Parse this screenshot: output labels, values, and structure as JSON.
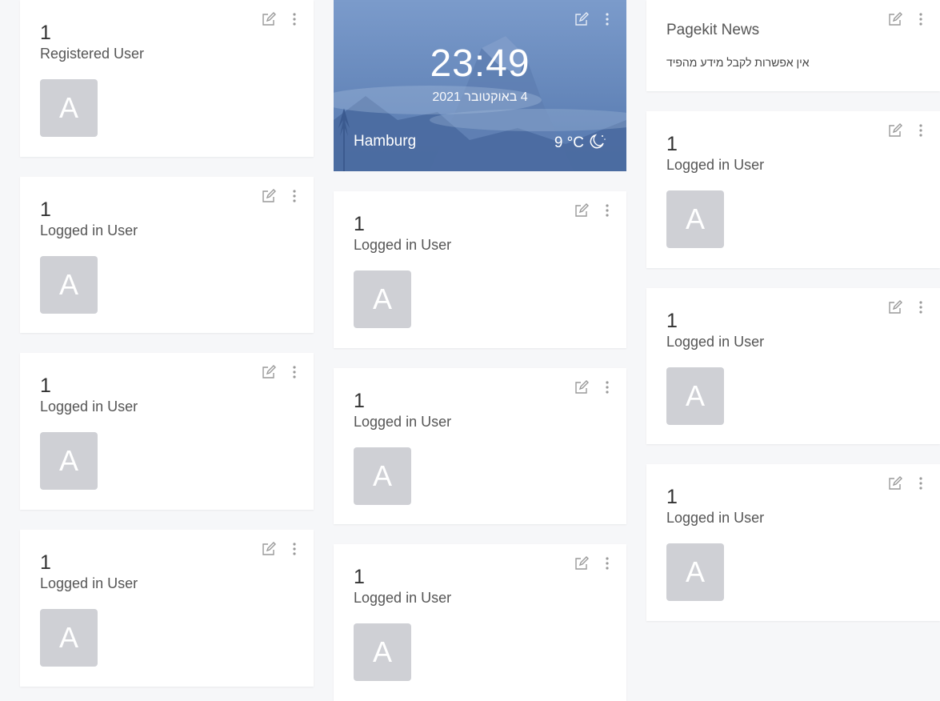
{
  "icons": {
    "edit": "edit-icon",
    "more": "more-vertical-icon",
    "moon": "moon-icon"
  },
  "colors": {
    "avatar_bg": "#cfd0d5",
    "page_bg": "#f6f7f9",
    "weather_bg": "#5a7db2"
  },
  "user_widgets": [
    {
      "count": "1",
      "label": "Registered User",
      "avatar_letter": "A"
    },
    {
      "count": "1",
      "label": "Logged in User",
      "avatar_letter": "A"
    },
    {
      "count": "1",
      "label": "Logged in User",
      "avatar_letter": "A"
    },
    {
      "count": "1",
      "label": "Logged in User",
      "avatar_letter": "A"
    },
    {
      "count": "1",
      "label": "Logged in User",
      "avatar_letter": "A"
    },
    {
      "count": "1",
      "label": "Logged in User",
      "avatar_letter": "A"
    },
    {
      "count": "1",
      "label": "Logged in User",
      "avatar_letter": "A"
    },
    {
      "count": "1",
      "label": "Logged in User",
      "avatar_letter": "A"
    },
    {
      "count": "1",
      "label": "Logged in User",
      "avatar_letter": "A"
    },
    {
      "count": "1",
      "label": "Logged in User",
      "avatar_letter": "A"
    }
  ],
  "weather": {
    "time": "23:49",
    "date": "4 באוקטובר 2021",
    "city": "Hamburg",
    "temperature": "9 °C"
  },
  "news": {
    "title": "Pagekit News",
    "message": "אין אפשרות לקבל מידע מהפיד"
  }
}
